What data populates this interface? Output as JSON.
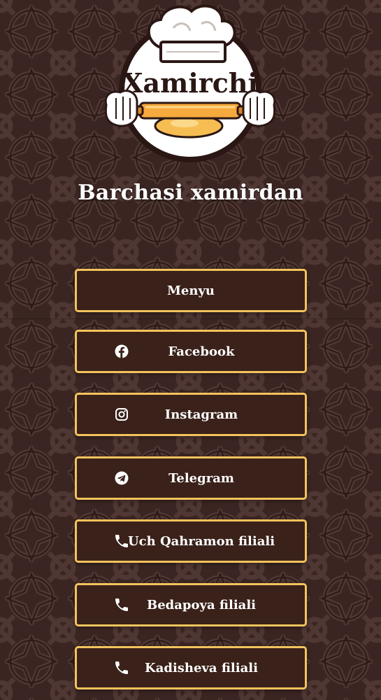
{
  "colors": {
    "background": "#3a2522",
    "pattern_line": "#4f3733",
    "button_border": "#f3c35c",
    "button_fill": "#3a2119",
    "text": "#ffffff"
  },
  "logo": {
    "brand_text": "Xamirchi"
  },
  "tagline": "Barchasi xamirdan",
  "links": [
    {
      "label": "Menyu",
      "icon": ""
    },
    {
      "label": "Facebook",
      "icon": "facebook-icon"
    },
    {
      "label": "Instagram",
      "icon": "instagram-icon"
    },
    {
      "label": "Telegram",
      "icon": "telegram-icon"
    },
    {
      "label": "Uch Qahramon filiali",
      "icon": "phone-icon"
    },
    {
      "label": "Bedapoya filiali",
      "icon": "phone-icon"
    },
    {
      "label": "Kadisheva filiali",
      "icon": "phone-icon"
    }
  ]
}
